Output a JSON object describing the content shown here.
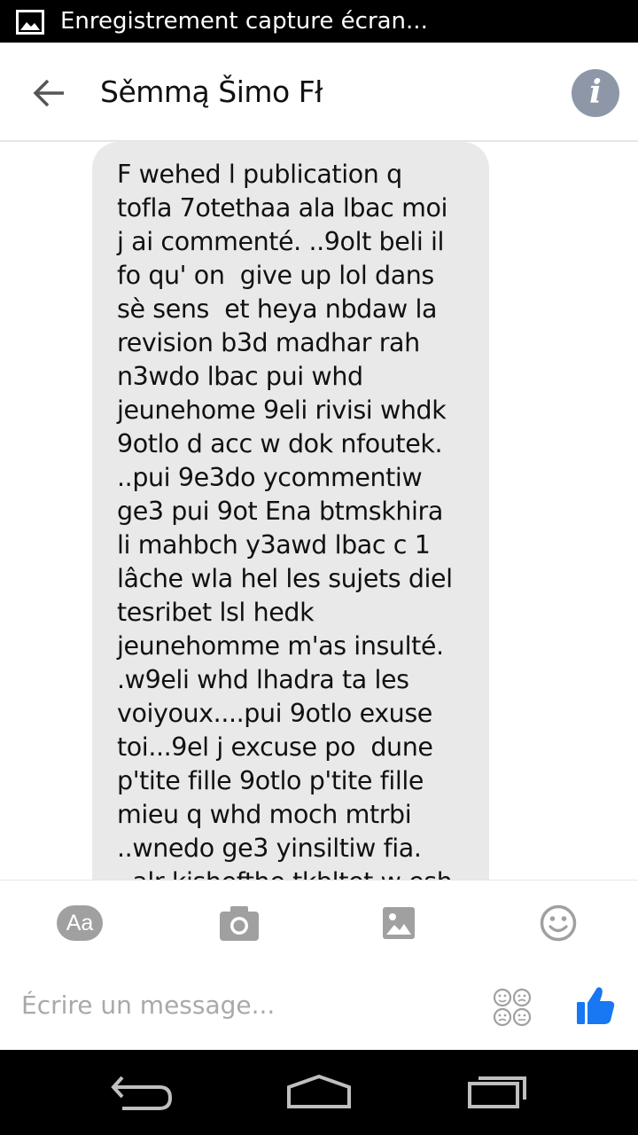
{
  "status_bar": {
    "notification_icon": "image-icon",
    "notification_text": "Enregistrement capture écran..."
  },
  "header": {
    "back_icon": "arrow-left-icon",
    "contact_name": "Sěmmą Šimo Fł",
    "info_icon": "info-icon",
    "info_glyph": "i"
  },
  "conversation": {
    "messages": [
      {
        "direction": "incoming",
        "lines": [
          "F wehed l publication q",
          "tofla 7otethaa ala lbac moi",
          "j ai commenté. ..9olt beli il",
          "fo qu' on  give up lol dans",
          "sè sens  et heya nbdaw la",
          "revision b3d madhar rah",
          "n3wdo lbac pui whd",
          "jeunehome 9eli rivisi whdk",
          "9otlo d acc w dok nfoutek.",
          "..pui 9e3do ycommentiw",
          "ge3 pui 9ot Ena btmskhira",
          "li mahbch y3awd lbac c 1",
          "lâche wla hel les sujets diel",
          "tesribet lsl hedk",
          "jeunehomme m'as insulté.",
          ".w9eli whd lhadra ta les",
          "voiyoux....pui 9otlo exuse",
          "toi...9el j excuse po  dune",
          "p'tite fille 9otlo p'tite fille",
          "mieu q whd moch mtrbi",
          "..wnedo ge3 yinsiltiw fia.",
          "..alr kishefthe tkbltet w esh"
        ]
      }
    ]
  },
  "composer": {
    "text_format_label": "Aa",
    "camera_icon": "camera-icon",
    "gallery_icon": "image-icon",
    "emoji_icon": "smiley-icon",
    "input_placeholder": "Écrire un message...",
    "stickers_icon": "stickers-icon",
    "like_icon": "thumbs-up-icon",
    "accent_color": "#1877f2"
  },
  "nav_bar": {
    "back_icon": "back-arrow-icon",
    "home_icon": "home-icon",
    "recents_icon": "recent-apps-icon"
  }
}
